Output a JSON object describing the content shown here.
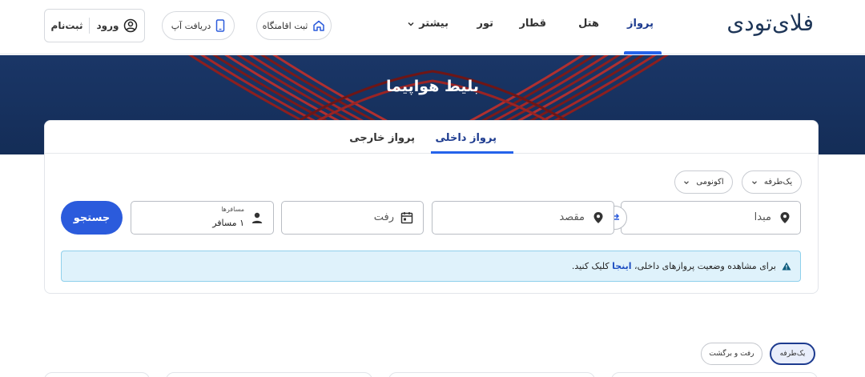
{
  "header": {
    "logo": "فلای‌تودی",
    "nav": [
      {
        "label": "پرواز",
        "active": true
      },
      {
        "label": "هتل"
      },
      {
        "label": "قطار"
      },
      {
        "label": "تور"
      },
      {
        "label": "بیشتر"
      }
    ],
    "register_accommodation": "ثبت اقامتگاه",
    "get_app": "دریافت آپ",
    "login": "ورود",
    "signup": "ثبت‌نام"
  },
  "hero": {
    "title": "بلیط هواپیما"
  },
  "search": {
    "tabs": [
      {
        "label": "پرواز داخلی",
        "active": true
      },
      {
        "label": "پرواز خارجی"
      }
    ],
    "trip_type": "یک‌طرفه",
    "cabin_class": "اکونومی",
    "origin_placeholder": "مبدا",
    "destination_placeholder": "مقصد",
    "departure_placeholder": "رفت",
    "passengers_label": "مسافرها",
    "passengers_value": "۱ مسافر",
    "search_button": "جستجو"
  },
  "notice": {
    "text_before": "برای مشاهده وضعیت پروازهای داخلی، ",
    "link": "اینجا",
    "text_after": " کلیک کنید."
  },
  "filters": {
    "one_way": "یک‌طرفه",
    "round_trip": "رفت و برگشت"
  },
  "colors": {
    "brand_blue": "#2b5bdc",
    "hero_navy": "#1a3667",
    "notice_bg": "#dff2fb"
  }
}
